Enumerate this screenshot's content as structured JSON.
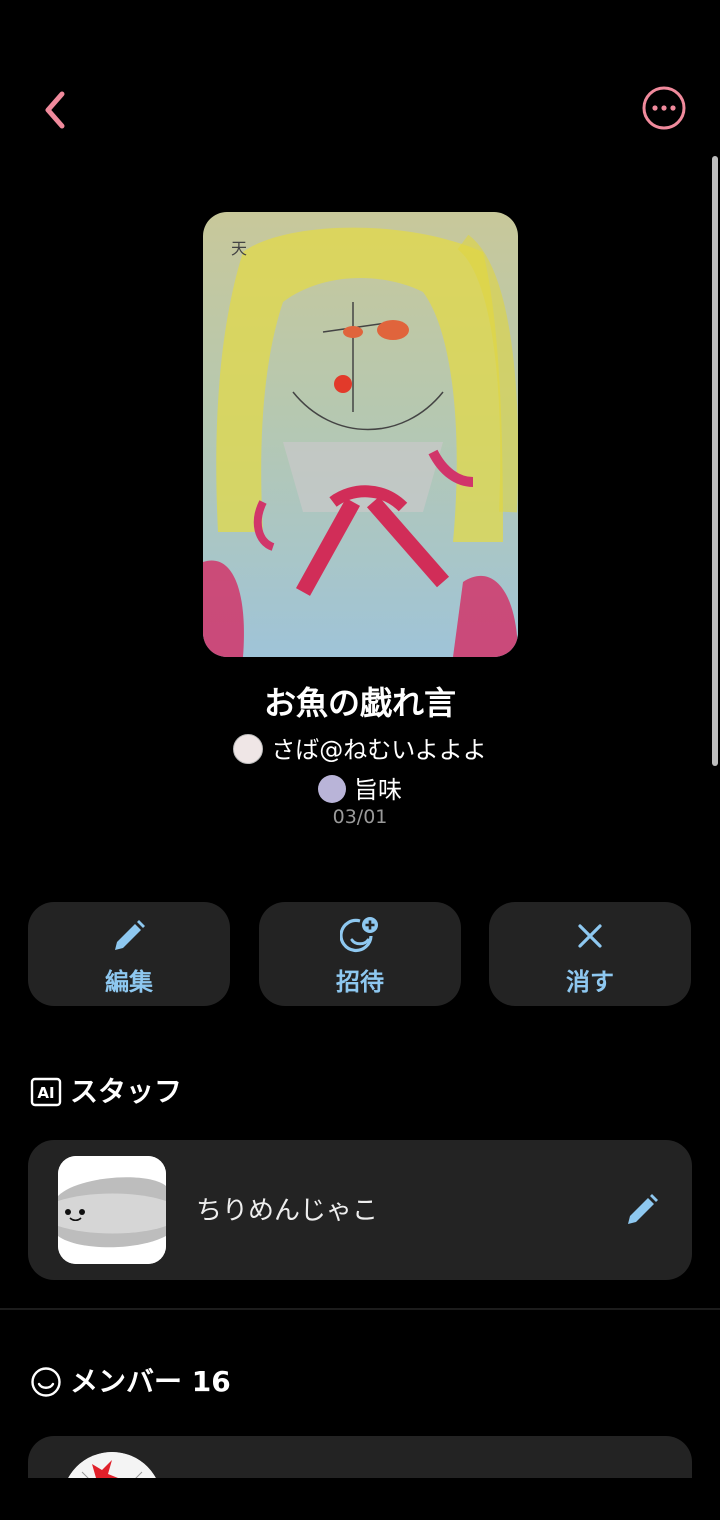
{
  "header": {
    "back_icon": "chevron-left-icon",
    "more_icon": "more-horizontal-circle-icon",
    "accent": "#f08a9c"
  },
  "group": {
    "title": "お魚の戯れ言",
    "owner": "さば@ねむいよよよ",
    "sub_member": "旨味",
    "date": "03/01"
  },
  "actions": [
    {
      "label": "編集",
      "icon": "pencil-icon"
    },
    {
      "label": "招待",
      "icon": "add-smile-icon"
    },
    {
      "label": "消す",
      "icon": "close-icon"
    }
  ],
  "staff": {
    "heading": "スタッフ",
    "heading_icon": "ai-badge-icon",
    "name": "ちりめんじゃこ",
    "edit_icon": "pencil-icon"
  },
  "members": {
    "heading": "メンバー 16",
    "heading_icon": "smile-icon"
  },
  "colors": {
    "accent_blue": "#8ec8f0",
    "card_bg": "#232323",
    "accent_pink": "#f08a9c"
  }
}
